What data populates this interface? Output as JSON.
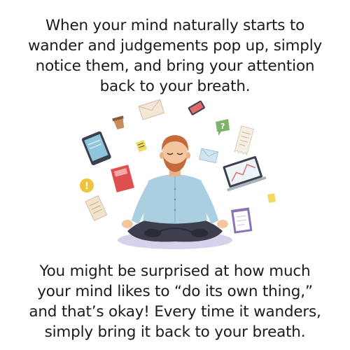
{
  "top_text": [
    "When your mind naturally starts to",
    "wander and judgements pop up, simply",
    "notice them, and bring your attention",
    "back to your breath."
  ],
  "bottom_text": [
    "You might be surprised at how much",
    "your mind likes to “do its own thing,”",
    "and that’s okay! Every time it wanders,",
    "simply bring it back to your breath."
  ],
  "illustration": {
    "subject": "meditating-man-icon",
    "floating_items": [
      "envelope-icon",
      "phone-icon",
      "coffee-cup-icon",
      "question-bubble-icon",
      "receipt-icon",
      "tablet-icon",
      "notebook-icon",
      "sticky-note-icon",
      "exclamation-bubble-icon",
      "laptop-chart-icon",
      "clipboard-icon",
      "document-icon"
    ]
  },
  "colors": {
    "text": "#1a1a1a",
    "shirt": "#a9cfe0",
    "skin": "#f3c6a0",
    "hair": "#c76a3a",
    "pants": "#3d3f4e",
    "cushion": "#d6d2ec"
  }
}
